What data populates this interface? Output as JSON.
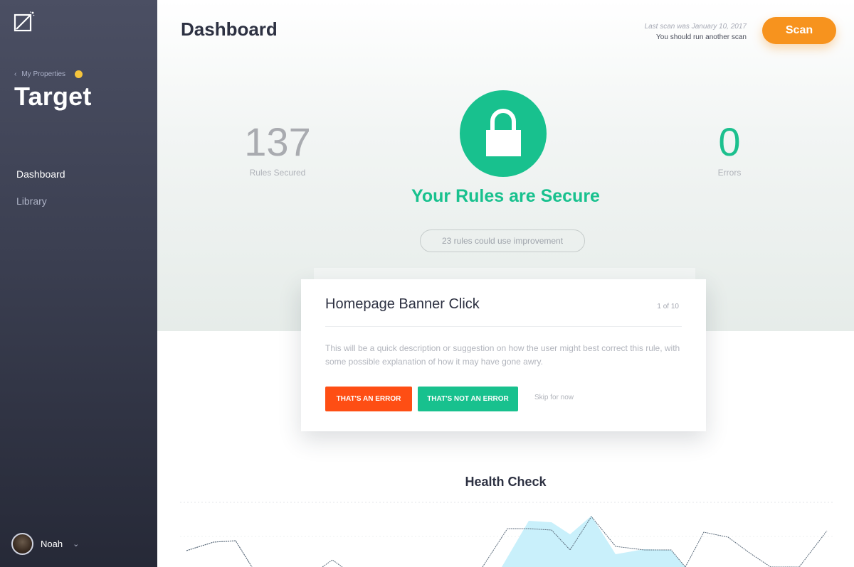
{
  "sidebar": {
    "back_label": "My Properties",
    "property_title": "Target",
    "nav": [
      {
        "label": "Dashboard",
        "active": true
      },
      {
        "label": "Library",
        "active": false
      }
    ],
    "user_name": "Noah"
  },
  "header": {
    "title": "Dashboard",
    "last_scan": "Last scan was January 10, 2017",
    "scan_hint": "You should run another scan",
    "scan_button": "Scan"
  },
  "stats": {
    "rules_secured": {
      "value": "137",
      "label": "Rules Secured"
    },
    "errors": {
      "value": "0",
      "label": "Errors"
    }
  },
  "status": {
    "message": "Your Rules are Secure",
    "improvement_pill": "23 rules could use improvement"
  },
  "card": {
    "title": "Homepage Banner Click",
    "count": "1 of 10",
    "description": "This will be a quick description or suggestion on how the user might best correct this rule, with some possible explanation of how it may have gone awry.",
    "error_button": "THAT'S AN ERROR",
    "not_error_button": "THAT'S NOT AN ERROR",
    "skip_button": "Skip for now"
  },
  "health_check": {
    "title": "Health Check"
  },
  "colors": {
    "accent_green": "#18c18e",
    "accent_orange": "#f7931e",
    "error_red": "#fe4e14",
    "chart_fill": "#c9f0fb"
  }
}
